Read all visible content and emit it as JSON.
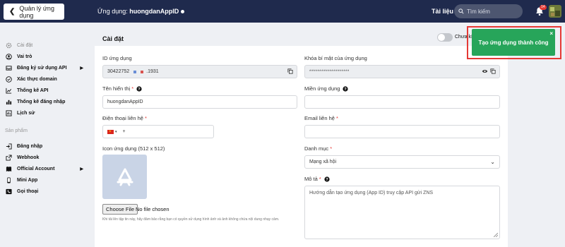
{
  "topbar": {
    "back_label": "Quản lý ứng dụng",
    "app_prefix": "Ứng dụng:",
    "app_name": "huongdanAppID",
    "docs": "Tài liệu",
    "search_placeholder": "Tìm kiếm",
    "notification_count": "14"
  },
  "sidebar": {
    "items": [
      {
        "label": "Cài đặt",
        "icon": "gear-icon"
      },
      {
        "label": "Vai trò",
        "icon": "user-circle-icon"
      },
      {
        "label": "Đăng ký sử dụng API",
        "icon": "inbox-icon"
      },
      {
        "label": "Xác thực domain",
        "icon": "check-circle-icon"
      },
      {
        "label": "Thống kê API",
        "icon": "chart-icon"
      },
      {
        "label": "Thống kê đăng nhập",
        "icon": "bar-chart-icon"
      },
      {
        "label": "Lịch sử",
        "icon": "history-icon"
      }
    ],
    "section_title": "Sản phẩm",
    "products": [
      {
        "label": "Đăng nhập",
        "icon": "login-icon"
      },
      {
        "label": "Webhook",
        "icon": "external-link-icon"
      },
      {
        "label": "Official Account",
        "icon": "book-icon"
      },
      {
        "label": "Mini App",
        "icon": "phone-icon"
      },
      {
        "label": "Gọi thoại",
        "icon": "call-icon"
      }
    ]
  },
  "panel": {
    "title": "Cài đặt",
    "toggle_label": "Chưa kí",
    "app_id_label": "ID ứng dụng",
    "app_id_value": "30422752",
    "app_id_tail": ".1931",
    "secret_label": "Khóa bí mật của ứng dụng",
    "secret_value": "********************",
    "display_name_label": "Tên hiển thị",
    "display_name_value": "huongdanAppID",
    "domain_label": "Miền ứng dụng",
    "phone_label": "Điện thoại liên hệ",
    "phone_value": "+",
    "email_label": "Email liên hệ",
    "icon_label": "Icon ứng dụng (512 x 512)",
    "category_label": "Danh mục",
    "category_value": "Mạng xã hội",
    "description_label": "Mô tả",
    "description_value": "Hướng dẫn tạo ứng dụng (App ID) truy cập API gửi ZNS",
    "file_button": "Choose File",
    "file_status": "No file chosen",
    "note": "Khi tải lên tập tin này, hãy đảm bảo rằng bạn có quyền sử dụng hình ảnh và ảnh không chứa nội dung nhạy cảm."
  },
  "toast": {
    "message": "Tạo ứng dụng thành công",
    "close": "×"
  },
  "colors": {
    "topbar": "#1f2a4d",
    "toast": "#27a55a",
    "highlight": "#e53935",
    "required": "#e53935"
  }
}
